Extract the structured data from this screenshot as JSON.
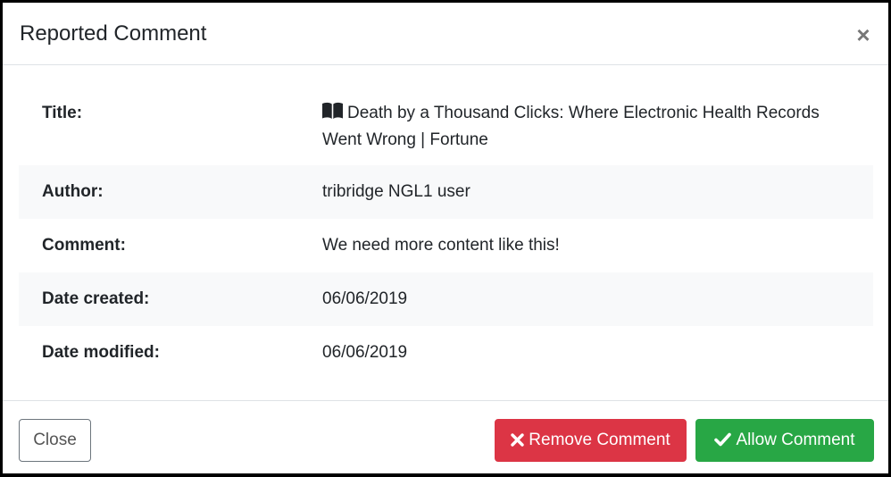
{
  "modal": {
    "title": "Reported Comment",
    "close_glyph": "×"
  },
  "details": [
    {
      "label": "Title:",
      "value": "Death by a Thousand Clicks: Where Electronic Health Records Went Wrong | Fortune",
      "icon": "book-open-icon"
    },
    {
      "label": "Author:",
      "value": "tribridge NGL1 user"
    },
    {
      "label": "Comment:",
      "value": "We need more content like this!"
    },
    {
      "label": "Date created:",
      "value": "06/06/2019"
    },
    {
      "label": "Date modified:",
      "value": "06/06/2019"
    }
  ],
  "footer": {
    "close_label": "Close",
    "remove_label": "Remove Comment",
    "remove_icon": "times-icon",
    "allow_label": "Allow Comment",
    "allow_icon": "check-icon"
  },
  "colors": {
    "danger": "#dc3545",
    "success": "#28a745",
    "stripe": "#f8f9fa",
    "border": "#dee2e6"
  }
}
